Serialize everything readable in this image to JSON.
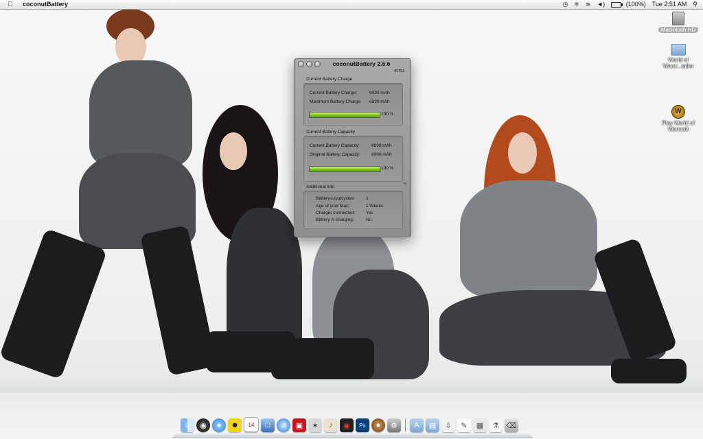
{
  "menubar": {
    "app_name": "coconutBattery",
    "battery_percent": "(100%)",
    "clock": "Tue 2:51 AM",
    "icons": [
      "apple-icon",
      "time-machine-icon",
      "bluetooth-icon",
      "wifi-icon",
      "volume-icon",
      "battery-icon",
      "spotlight-icon"
    ]
  },
  "desktop": {
    "icons": [
      {
        "label": "Macintosh HD",
        "icon": "hard-drive-icon"
      },
      {
        "label": "World of Warcr...taller",
        "icon": "folder-icon"
      },
      {
        "label": "Play World of Warcraft",
        "icon": "wow-icon"
      }
    ]
  },
  "window": {
    "title": "coconutBattery 2.6.6",
    "arch": "INTEL",
    "charge": {
      "section": "Current Battery Charge",
      "current_label": "Current Battery Charge:",
      "current_value": "6930 mAh",
      "max_label": "Maximum Battery Charge:",
      "max_value": "6930 mAh",
      "percent_text": "100 %",
      "fill": 1.0
    },
    "capacity": {
      "section": "Current Battery Capacity",
      "current_label": "Current Battery Capacity:",
      "current_value": "6930 mAh",
      "original_label": "Original Battery Capacity:",
      "original_value": "6900 mAh",
      "percent_text": "100 %",
      "fill": 1.0
    },
    "info": {
      "section": "Additional Info",
      "rows": [
        {
          "label": "Battery-Loadcycles:",
          "value": "1"
        },
        {
          "label": "Age of your Mac:",
          "value": "1 Weeks"
        },
        {
          "label": "Charger connected:",
          "value": "Yes"
        },
        {
          "label": "Battery is charging:",
          "value": "No"
        }
      ]
    }
  },
  "dock": {
    "apps": [
      "finder-icon",
      "dashboard-icon",
      "safari-icon",
      "aim-icon",
      "ical-icon",
      "iphoto-icon",
      "itunes-icon",
      "photo-booth-icon",
      "star-icon",
      "guitar-icon",
      "antivirus-icon",
      "photoshop-icon",
      "coconutbattery-icon",
      "preferences-icon"
    ],
    "others": [
      "applications-folder-icon",
      "documents-folder-icon",
      "downloads-icon",
      "textedit-icon",
      "preview-icon",
      "script-icon",
      "trash-icon"
    ]
  },
  "colors": {
    "bar_green": "#7fc31e",
    "window_bg": "#9a9a9a"
  }
}
